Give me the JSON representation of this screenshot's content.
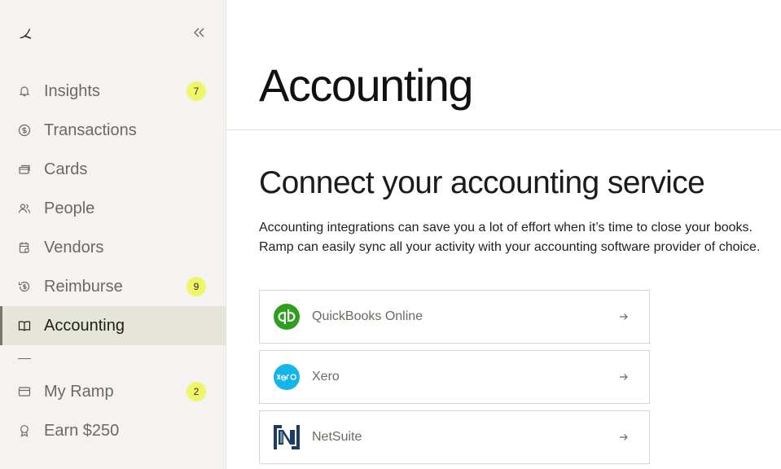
{
  "sidebar": {
    "nav": [
      {
        "label": "Insights",
        "icon": "bell-icon",
        "badge": "7"
      },
      {
        "label": "Transactions",
        "icon": "dollar-circle-icon"
      },
      {
        "label": "Cards",
        "icon": "cards-icon"
      },
      {
        "label": "People",
        "icon": "people-icon"
      },
      {
        "label": "Vendors",
        "icon": "vendors-icon"
      },
      {
        "label": "Reimburse",
        "icon": "reimburse-icon",
        "badge": "9"
      },
      {
        "label": "Accounting",
        "icon": "book-icon",
        "active": true
      }
    ],
    "secondary": [
      {
        "label": "My Ramp",
        "icon": "wallet-icon",
        "badge": "2"
      },
      {
        "label": "Earn $250",
        "icon": "award-icon"
      }
    ]
  },
  "main": {
    "title": "Accounting",
    "section_title": "Connect your accounting service",
    "description_lines": [
      "Accounting integrations can save you a lot of effort when it’s time to close your books.",
      "Ramp can easily sync all your activity with your accounting software provider of choice."
    ],
    "providers": [
      {
        "name": "QuickBooks Online",
        "logo": "quickbooks-logo",
        "color": "#2ca01c"
      },
      {
        "name": "Xero",
        "logo": "xero-logo",
        "color": "#13b5ea"
      },
      {
        "name": "NetSuite",
        "logo": "netsuite-logo",
        "color": "#1b3d5f"
      }
    ]
  }
}
